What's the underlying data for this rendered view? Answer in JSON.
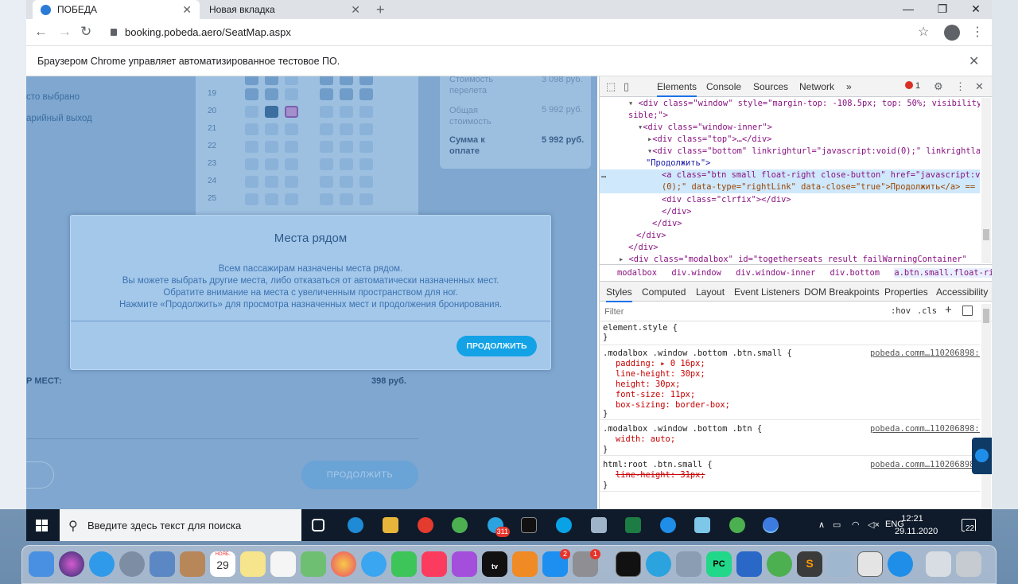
{
  "browser": {
    "tabs": [
      {
        "title": "ПОБЕДА",
        "active": true
      },
      {
        "title": "Новая вкладка",
        "active": false
      }
    ],
    "url": "booking.pobeda.aero/SeatMap.aspx",
    "infobar_text": "Браузером Chrome управляет автоматизированное тестовое ПО.",
    "icons": {
      "back": "back-arrow-icon",
      "forward": "forward-arrow-icon",
      "reload": "reload-icon",
      "lock": "lock-icon",
      "bookmark": "star-icon",
      "profile": "account-icon",
      "menu": "kebab-menu-icon"
    }
  },
  "page": {
    "legend": [
      "сто выбрано",
      "арийный выход"
    ],
    "rows": [
      "19",
      "20",
      "21",
      "22",
      "23",
      "24",
      "25"
    ],
    "price_panel": [
      {
        "label": "Стоимость перелета",
        "value": "3 098 руб."
      },
      {
        "label": "Общая стоимость",
        "value": "5 992 руб."
      },
      {
        "label": "Сумма к оплате",
        "value": "5 992 руб."
      }
    ],
    "total_label": "Р МЕСТ:",
    "total_price": "398 руб.",
    "continue_button": "ПРОДОЛЖИТЬ"
  },
  "modal": {
    "title": "Места рядом",
    "lines": [
      "Всем пассажирам назначены места рядом.",
      "Вы можете выбрать другие места, либо отказаться от автоматически назначенных мест.",
      "Обратите внимание на места с увеличенным пространством для ног.",
      "Нажмите «Продолжить» для просмотра назначенных мест и продолжения бронирования."
    ],
    "button": "ПРОДОЛЖИТЬ"
  },
  "devtools": {
    "tabs": [
      "Elements",
      "Console",
      "Sources",
      "Network",
      "»"
    ],
    "active_tab": "Elements",
    "error_count": "1",
    "dom": {
      "line1": "<div class=\"window\" style=\"margin-top: -108.5px; top: 50%; visibility: vi",
      "line1b": "sible;\">",
      "line2": "<div class=\"window-inner\">",
      "line3": "<div class=\"top\">…</div>",
      "line4": "<div class=\"bottom\" linkrighturl=\"javascript:void(0);\" linkrightlabel=",
      "line4b": "\"Продолжить\">",
      "line5": "<a class=\"btn small float-right close-button\" href=\"javascript:void",
      "line5b": "(0);\" data-type=\"rightLink\" data-close=\"true\">Продолжить</a> == $0",
      "line6": "<div class=\"clrfix\"></div>",
      "line7": "</div>",
      "line8": "</div>",
      "line9": "</div>",
      "line10": "</div>",
      "line11": "<div class=\"modalbox\" id=\"togetherseats_result_failWarningContainer\""
    },
    "breadcrumbs": [
      "modalbox",
      "div.window",
      "div.window-inner",
      "div.bottom",
      "a.btn.small.float-right.close-button"
    ],
    "sub_tabs": [
      "Styles",
      "Computed",
      "Layout",
      "Event Listeners",
      "DOM Breakpoints",
      "Properties",
      "Accessibility"
    ],
    "filter_placeholder": "Filter",
    "hov": ":hov",
    "cls": ".cls",
    "styles": {
      "element_style": "element.style {",
      "close": "}",
      "rule1": ".modalbox .window .bottom .btn.small {",
      "rule1_src": "pobeda.comm…110206898:5",
      "rule1_props": [
        "padding: ▸ 0 16px;",
        "line-height: 30px;",
        "height: 30px;",
        "font-size: 11px;",
        "box-sizing: border-box;"
      ],
      "rule2": ".modalbox .window .bottom .btn {",
      "rule2_src": "pobeda.comm…110206898:5",
      "rule2_prop": "width: auto;",
      "rule3": "html:root .btn.small {",
      "rule3_src": "pobeda.comm…110206898:5",
      "rule3_prop": "line-height: 31px;"
    }
  },
  "taskbar": {
    "search_placeholder": "Введите здесь текст для поиска",
    "telegram_badge": "311",
    "language": "ENG",
    "time": "12:21",
    "date": "29.11.2020",
    "notifications": "22"
  },
  "dock": {
    "calendar_month": "НОЯБ.",
    "calendar_day": "29",
    "appstore_badge": "2",
    "settings_badge": "1",
    "pycharm_label": "PC"
  }
}
